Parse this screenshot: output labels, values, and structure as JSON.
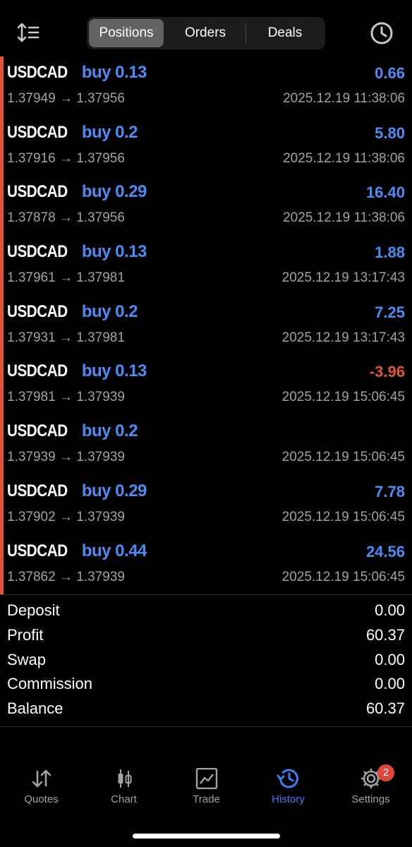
{
  "tabs": [
    {
      "label": "Positions",
      "active": true
    },
    {
      "label": "Orders",
      "active": false
    },
    {
      "label": "Deals",
      "active": false
    }
  ],
  "deals": [
    {
      "symbol": "USDCAD",
      "trade": "buy 0.13",
      "price": "1.37949 → 1.37956",
      "profit": "0.66",
      "time": "2025.12.19 11:38:06"
    },
    {
      "symbol": "USDCAD",
      "trade": "buy 0.2",
      "price": "1.37916 → 1.37956",
      "profit": "5.80",
      "time": "2025.12.19 11:38:06"
    },
    {
      "symbol": "USDCAD",
      "trade": "buy 0.29",
      "price": "1.37878 → 1.37956",
      "profit": "16.40",
      "time": "2025.12.19 11:38:06"
    },
    {
      "symbol": "USDCAD",
      "trade": "buy 0.13",
      "price": "1.37961 → 1.37981",
      "profit": "1.88",
      "time": "2025.12.19 13:17:43"
    },
    {
      "symbol": "USDCAD",
      "trade": "buy 0.2",
      "price": "1.37931 → 1.37981",
      "profit": "7.25",
      "time": "2025.12.19 13:17:43"
    },
    {
      "symbol": "USDCAD",
      "trade": "buy 0.13",
      "price": "1.37981 → 1.37939",
      "profit": "-3.96",
      "time": "2025.12.19 15:06:45"
    },
    {
      "symbol": "USDCAD",
      "trade": "buy 0.2",
      "price": "1.37939 → 1.37939",
      "profit": "",
      "time": "2025.12.19 15:06:45"
    },
    {
      "symbol": "USDCAD",
      "trade": "buy 0.29",
      "price": "1.37902 → 1.37939",
      "profit": "7.78",
      "time": "2025.12.19 15:06:45"
    },
    {
      "symbol": "USDCAD",
      "trade": "buy 0.44",
      "price": "1.37862 → 1.37939",
      "profit": "24.56",
      "time": "2025.12.19 15:06:45"
    }
  ],
  "summary": [
    {
      "label": "Deposit",
      "value": "0.00"
    },
    {
      "label": "Profit",
      "value": "60.37"
    },
    {
      "label": "Swap",
      "value": "0.00"
    },
    {
      "label": "Commission",
      "value": "0.00"
    },
    {
      "label": "Balance",
      "value": "60.37"
    }
  ],
  "bottom_nav": [
    {
      "label": "Quotes",
      "icon": "quotes-icon"
    },
    {
      "label": "Chart",
      "icon": "chart-icon"
    },
    {
      "label": "Trade",
      "icon": "trade-icon"
    },
    {
      "label": "History",
      "icon": "history-icon",
      "active": true
    },
    {
      "label": "Settings",
      "icon": "gear-icon",
      "badge": "2"
    }
  ],
  "colors": {
    "accent": "#3d7ff5",
    "loss": "#e0553c",
    "background": "#000000"
  }
}
